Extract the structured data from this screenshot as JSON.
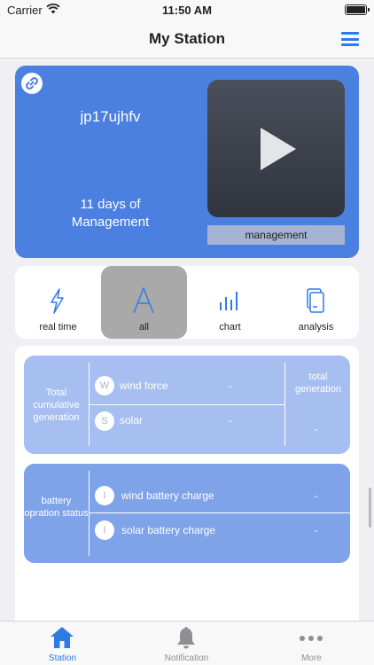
{
  "status_bar": {
    "carrier": "Carrier",
    "time": "11:50 AM"
  },
  "nav": {
    "title": "My Station",
    "menu_icon": "hamburger-menu-icon"
  },
  "station": {
    "name": "jp17ujhfv",
    "days_line1": "11 days of",
    "days_line2": "Management",
    "management_label": "management",
    "link_icon": "link-icon",
    "play_icon": "play-icon"
  },
  "tabs": [
    {
      "label": "real time",
      "icon": "lightning-icon"
    },
    {
      "label": "all",
      "icon": "letter-a-icon"
    },
    {
      "label": "chart",
      "icon": "bar-chart-icon"
    },
    {
      "label": "analysis",
      "icon": "document-icon"
    }
  ],
  "generation_panel": {
    "side_label": "Total cumulative generation",
    "total_label": "total generation",
    "total_value": "-",
    "rows": [
      {
        "badge": "W",
        "label": "wind force",
        "value": "-"
      },
      {
        "badge": "S",
        "label": "solar",
        "value": "-"
      }
    ]
  },
  "battery_panel": {
    "side_label": "battery opration status",
    "rows": [
      {
        "badge": "I",
        "label": "wind battery charge",
        "value": "-"
      },
      {
        "badge": "I",
        "label": "solar battery charge",
        "value": "-"
      }
    ]
  },
  "tab_bar": [
    {
      "label": "Station",
      "icon": "home-icon"
    },
    {
      "label": "Notification",
      "icon": "bell-icon"
    },
    {
      "label": "More",
      "icon": "more-dots-icon"
    }
  ],
  "colors": {
    "accent": "#2f7be6",
    "station_card": "#4b7fe0",
    "panel_generation": "#a6bff0",
    "panel_battery": "#7fa3e8",
    "tab_active": "#a9a9a9",
    "tabbar_inactive": "#8e8e93"
  }
}
